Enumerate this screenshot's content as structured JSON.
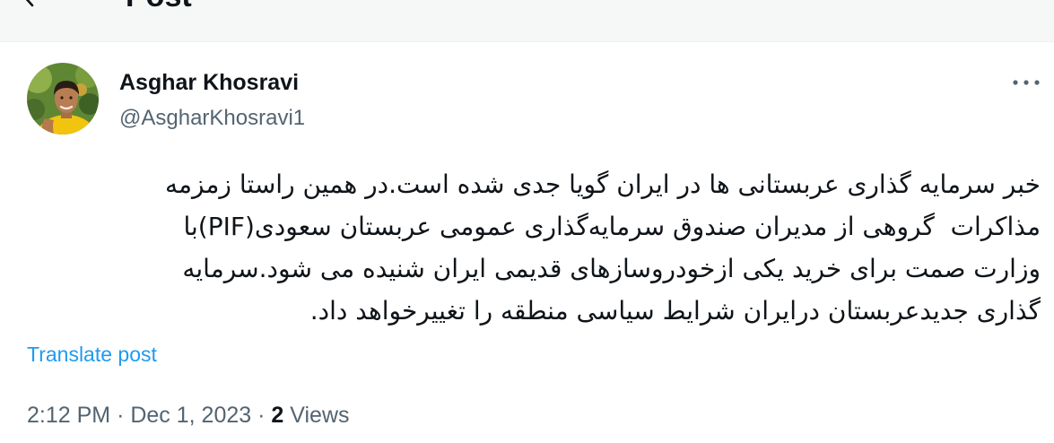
{
  "header": {
    "title": "Post",
    "back_icon": "back-arrow-icon"
  },
  "author": {
    "name": "Asghar Khosravi",
    "handle": "@AsgharKhosravi1",
    "avatar_icon": "avatar-photo"
  },
  "actions": {
    "more_icon": "more-horizontal-icon"
  },
  "tweet": {
    "text_lines": [
      "خبر سرمایه گذاری عربستانی ها در ایران گویا جدی شده است.در همین راستا زمزمه",
      "مذاکرات  گروهی از مدیران صندوق سرمایه‌گذاری عمومی عربستان سعودی(PIF)با",
      "وزارت صمت برای خرید یکی ازخودروسازهای قدیمی ایران شنیده می شود.سرمایه",
      "گذاری جدیدعربستان درایران شرایط سیاسی منطقه را تغییرخواهد داد."
    ],
    "translate_label": "Translate post"
  },
  "meta": {
    "time": "2:12 PM",
    "separator": "·",
    "date": "Dec 1, 2023",
    "views_count": "2",
    "views_label": "Views"
  },
  "colors": {
    "text": "#0f1419",
    "secondary": "#536471",
    "accent": "#1d9bf0",
    "header_bg": "#f6f7f7"
  }
}
